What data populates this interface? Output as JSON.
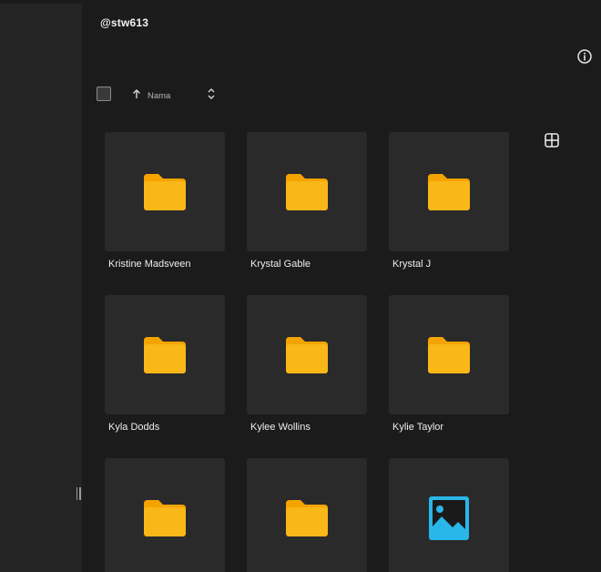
{
  "header": {
    "title": "@stw613"
  },
  "toolbar": {
    "view_toggle_icon": "grid-view-icon",
    "info_icon": "info-icon"
  },
  "sort": {
    "label": "Nama",
    "direction": "ascending"
  },
  "colors": {
    "folder": "#f9b718",
    "folder_back": "#f5a300",
    "image_icon": "#29b6e8",
    "tile_bg": "#2a2a2b",
    "app_bg": "#1b1b1c",
    "sidebar_bg": "#242425"
  },
  "items": [
    {
      "name": "Kristine Madsveen",
      "type": "folder"
    },
    {
      "name": "Krystal Gable",
      "type": "folder"
    },
    {
      "name": "Krystal J",
      "type": "folder"
    },
    {
      "name": "Kyla Dodds",
      "type": "folder"
    },
    {
      "name": "Kylee Wollins",
      "type": "folder"
    },
    {
      "name": "Kylie Taylor",
      "type": "folder"
    },
    {
      "name": "",
      "type": "folder"
    },
    {
      "name": "",
      "type": "folder"
    },
    {
      "name": "",
      "type": "image"
    }
  ]
}
